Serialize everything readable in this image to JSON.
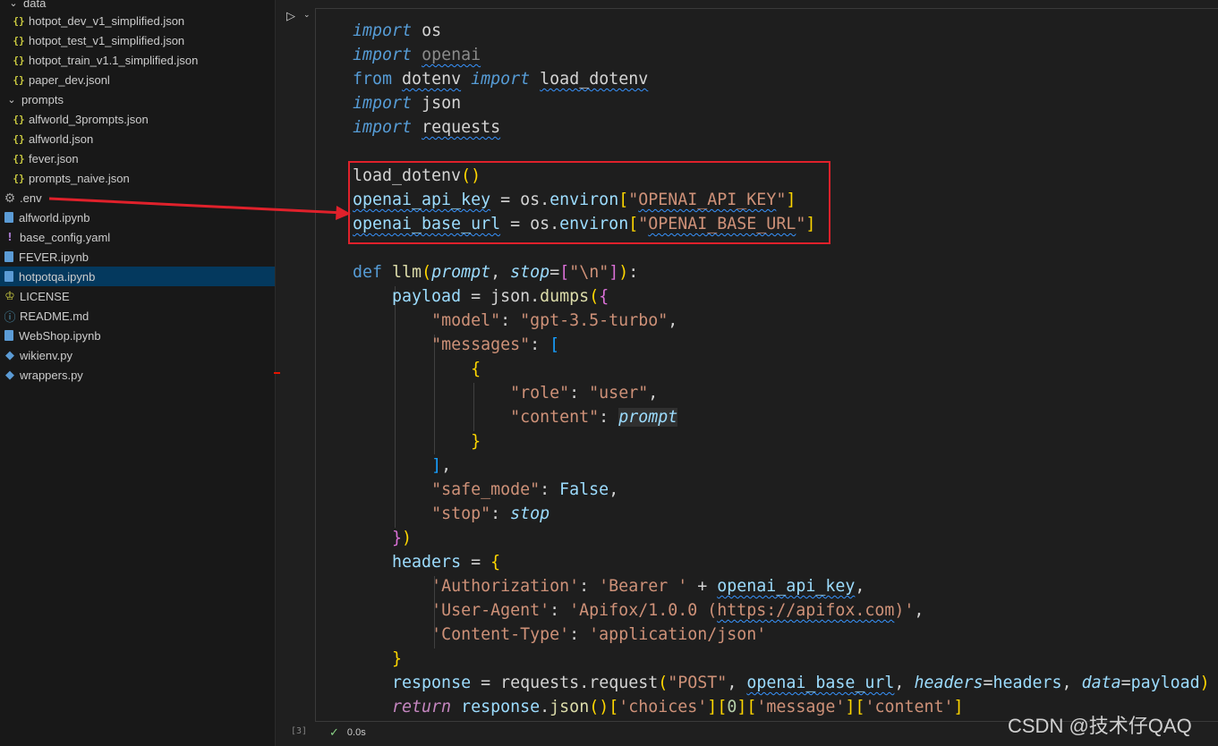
{
  "explorer": {
    "items": [
      {
        "label": "data",
        "kind": "folder"
      },
      {
        "label": "hotpot_dev_v1_simplified.json",
        "kind": "json"
      },
      {
        "label": "hotpot_test_v1_simplified.json",
        "kind": "json"
      },
      {
        "label": "hotpot_train_v1.1_simplified.json",
        "kind": "json"
      },
      {
        "label": "paper_dev.jsonl",
        "kind": "json"
      },
      {
        "label": "prompts",
        "kind": "folder"
      },
      {
        "label": "alfworld_3prompts.json",
        "kind": "json"
      },
      {
        "label": "alfworld.json",
        "kind": "json"
      },
      {
        "label": "fever.json",
        "kind": "json"
      },
      {
        "label": "prompts_naive.json",
        "kind": "json"
      },
      {
        "label": ".env",
        "kind": "env"
      },
      {
        "label": "alfworld.ipynb",
        "kind": "notebook"
      },
      {
        "label": "base_config.yaml",
        "kind": "yaml"
      },
      {
        "label": "FEVER.ipynb",
        "kind": "notebook"
      },
      {
        "label": "hotpotqa.ipynb",
        "kind": "notebook",
        "selected": true
      },
      {
        "label": "LICENSE",
        "kind": "license"
      },
      {
        "label": "README.md",
        "kind": "markdown"
      },
      {
        "label": "WebShop.ipynb",
        "kind": "notebook"
      },
      {
        "label": "wikienv.py",
        "kind": "python"
      },
      {
        "label": "wrappers.py",
        "kind": "python"
      }
    ]
  },
  "cell": {
    "execution_count": "[3]",
    "duration": "0.0s",
    "status_icon": "check-icon",
    "code": {
      "l1_kw": "import",
      "l1_mod": "os",
      "l2_kw": "import",
      "l2_mod": "openai",
      "l3_from": "from",
      "l3_mod": "dotenv",
      "l3_import": "import",
      "l3_name": "load_dotenv",
      "l4_kw": "import",
      "l4_mod": "json",
      "l5_kw": "import",
      "l5_mod": "requests",
      "l7_fn": "load_dotenv",
      "l8_var": "openai_api_key",
      "l8_obj": "os",
      "l8_attr": "environ",
      "l8_q1": "\"",
      "l8_key": "OPENAI_API_KEY",
      "l8_q2": "\"",
      "l9_var": "openai_base_url",
      "l9_obj": "os",
      "l9_attr": "environ",
      "l9_q1": "\"",
      "l9_key": "OPENAI_BASE_URL",
      "l9_q2": "\"",
      "l11_def": "def",
      "l11_fn": "llm",
      "l11_p1": "prompt",
      "l11_p2": "stop",
      "l11_default": "\"\\n\"",
      "l12_var": "payload",
      "l12_obj": "json",
      "l12_fn": "dumps",
      "l13_key": "\"model\"",
      "l13_val": "\"gpt-3.5-turbo\"",
      "l14_key": "\"messages\"",
      "l16_key": "\"role\"",
      "l16_val": "\"user\"",
      "l17_key": "\"content\"",
      "l17_val": "prompt",
      "l20_key": "\"safe_mode\"",
      "l20_val": "False",
      "l21_key": "\"stop\"",
      "l21_val": "stop",
      "l23_var": "headers",
      "l24_key": "'Authorization'",
      "l24_val": "'Bearer '",
      "l24_var": "openai_api_key",
      "l25_key": "'User-Agent'",
      "l25_a": "'Apifox/1.0.0 (",
      "l25_url": "https://apifox.com",
      "l25_b": ")'",
      "l26_key": "'Content-Type'",
      "l26_val": "'application/json'",
      "l28_var": "response",
      "l28_obj": "requests",
      "l28_fn": "request",
      "l28_method": "\"POST\"",
      "l28_arg": "openai_base_url",
      "l28_k1": "headers",
      "l28_v1": "headers",
      "l28_k2": "data",
      "l28_v2": "payload",
      "l29_ret": "return",
      "l29_obj": "response",
      "l29_fn": "json",
      "l29_k1": "'choices'",
      "l29_i": "0",
      "l29_k2": "'message'",
      "l29_k3": "'content'"
    }
  },
  "watermark": "CSDN @技术仔QAQ",
  "colors": {
    "annotation": "#e0212b",
    "selection": "#04395e",
    "keyword": "#569cd6",
    "string": "#ce9178"
  }
}
